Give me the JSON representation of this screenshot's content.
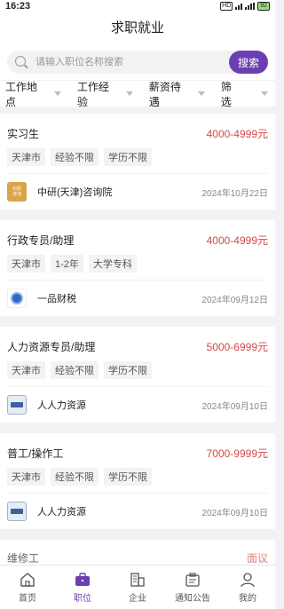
{
  "status": {
    "time": "16:23",
    "hd": "HD",
    "battery": "92"
  },
  "header": {
    "title": "求职就业"
  },
  "search": {
    "placeholder": "请输入职位名称搜索",
    "button_label": "搜索"
  },
  "filters": [
    {
      "label": "工作地点"
    },
    {
      "label": "工作经验"
    },
    {
      "label": "薪资待遇"
    },
    {
      "label": "筛选"
    }
  ],
  "jobs": [
    {
      "title": "实习生",
      "salary": "4000-4999元",
      "tags": [
        "天津市",
        "经验不限",
        "学历不限"
      ],
      "company": "中研(天津)咨询院",
      "date": "2024年10月22日",
      "logo": "中研\n咨询"
    },
    {
      "title": "行政专员/助理",
      "salary": "4000-4999元",
      "tags": [
        "天津市",
        "1-2年",
        "大学专科"
      ],
      "company": "一品财税",
      "date": "2024年09月12日",
      "logo": ""
    },
    {
      "title": "人力资源专员/助理",
      "salary": "5000-6999元",
      "tags": [
        "天津市",
        "经验不限",
        "学历不限"
      ],
      "company": "人人力资源",
      "date": "2024年09月10日",
      "logo": ""
    },
    {
      "title": "普工/操作工",
      "salary": "7000-9999元",
      "tags": [
        "天津市",
        "经验不限",
        "学历不限"
      ],
      "company": "人人力资源",
      "date": "2024年09月10日",
      "logo": ""
    }
  ],
  "peek": {
    "title": "维修工",
    "salary": "面议"
  },
  "tabs": [
    {
      "label": "首页",
      "icon": "home-icon"
    },
    {
      "label": "职位",
      "icon": "briefcase-icon",
      "active": true
    },
    {
      "label": "企业",
      "icon": "building-icon"
    },
    {
      "label": "通知公告",
      "icon": "notice-icon"
    },
    {
      "label": "我的",
      "icon": "user-icon"
    }
  ],
  "colors": {
    "accent": "#6b3fb2",
    "salary": "#d24a4a"
  }
}
